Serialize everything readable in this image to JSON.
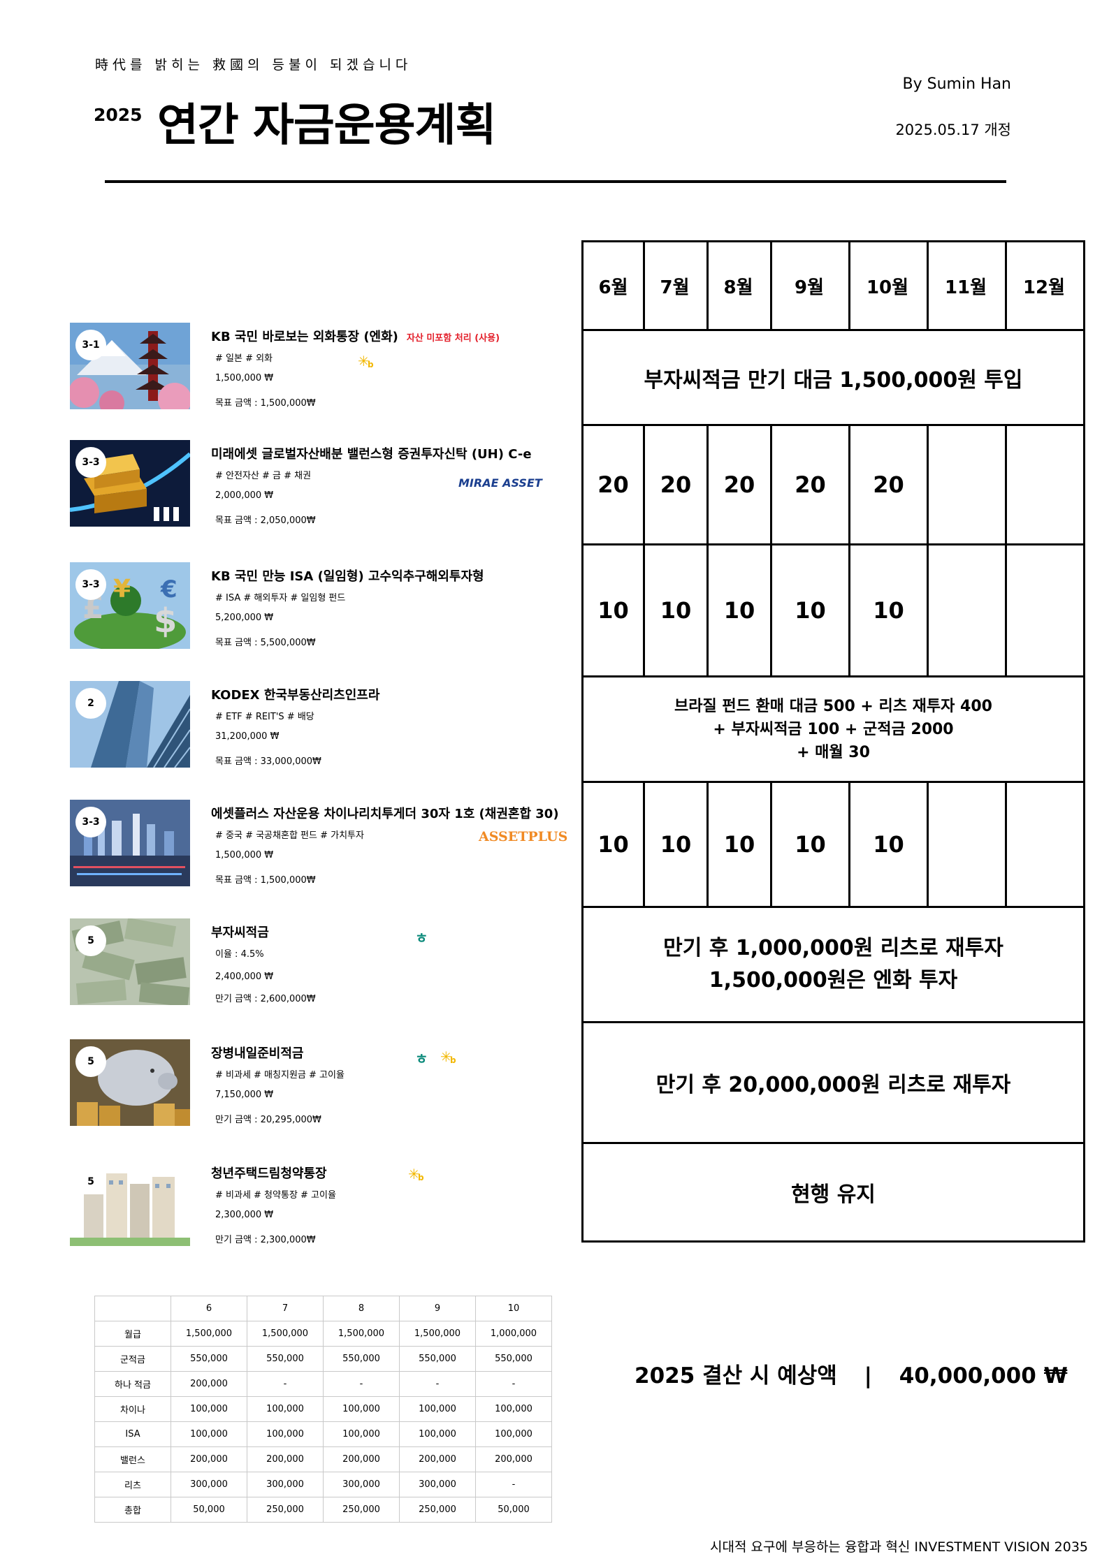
{
  "header": {
    "motto": "時代를 밝히는 救國의 등불이 되겠습니다",
    "year": "2025",
    "title": "연간 자금운용계획",
    "author": "By Sumin Han",
    "revised": "2025.05.17 개정"
  },
  "items": [
    {
      "badge": "3-1",
      "name": "KB 국민 바로보는 외화통장 (엔화)",
      "note": "자산 미포함 처리 (사용)",
      "tags": "# 일본  # 외화",
      "amount": "1,500,000 ₩",
      "target": "목표 금액 : 1,500,000₩",
      "logo_text": "KB",
      "logo_icon": "kb-star-icon",
      "theme": "mount-fuji"
    },
    {
      "badge": "3-3",
      "name": "미래에셋 글로벌자산배분 밸런스형 증권투자신탁 (UH) C-e",
      "note": "",
      "tags": "# 안전자산  # 금  # 채권",
      "amount": "2,000,000 ₩",
      "target": "목표 금액 : 2,050,000₩",
      "logo_text": "MIRAE ASSET",
      "logo_icon": "mirae-asset-logo",
      "theme": "gold-bars"
    },
    {
      "badge": "3-3",
      "name": "KB 국민 만능 ISA (일임형) 고수익추구해외투자형",
      "note": "",
      "tags": "# ISA  # 해외투자  # 일임형 펀드",
      "amount": "5,200,000 ₩",
      "target": "목표 금액 : 5,500,000₩",
      "logo_text": "",
      "logo_icon": "",
      "theme": "currency-globe"
    },
    {
      "badge": "2",
      "name": "KODEX 한국부동산리츠인프라",
      "note": "",
      "tags": "# ETF  # REIT'S  # 배당",
      "amount": "31,200,000 ₩",
      "target": "목표 금액 : 33,000,000₩",
      "logo_text": "",
      "logo_icon": "",
      "theme": "skyscrapers"
    },
    {
      "badge": "3-3",
      "name": "에셋플러스 자산운용 차이나리치투게더 30자 1호 (채권혼합 30)",
      "note": "",
      "tags": "# 중국  # 국공채혼합 펀드  # 가치투자",
      "amount": "1,500,000 ₩",
      "target": "목표 금액 : 1,500,000₩",
      "logo_text": "ASSETPLUS",
      "logo_icon": "assetplus-logo",
      "theme": "city-night"
    },
    {
      "badge": "5",
      "name": "부자씨적금",
      "note": "",
      "tags": "이율 : 4.5%",
      "amount": "2,400,000 ₩",
      "target": "만기 금액 : 2,600,000₩",
      "logo_text": "",
      "logo_icon": "hana-logo-icon",
      "theme": "dollar-bills"
    },
    {
      "badge": "5",
      "name": "장병내일준비적금",
      "note": "",
      "tags": "# 비과세  # 매칭지원금  # 고이율",
      "amount": "7,150,000 ₩",
      "target": "만기 금액 : 20,295,000₩",
      "logo_text": "",
      "logo_icon": "hana-kb-logos",
      "theme": "piggy-bank"
    },
    {
      "badge": "5",
      "name": "청년주택드림청약통장",
      "note": "",
      "tags": "# 비과세  # 청약통장  # 고이율",
      "amount": "2,300,000 ₩",
      "target": "만기 금액 : 2,300,000₩",
      "logo_text": "",
      "logo_icon": "kb-star-icon",
      "theme": "apartments"
    }
  ],
  "grid": {
    "months": [
      "6월",
      "7월",
      "8월",
      "9월",
      "10월",
      "11월",
      "12월"
    ],
    "row1_text": "부자씨적금 만기 대금 1,500,000원 투입",
    "row2_values": [
      "20",
      "20",
      "20",
      "20",
      "20",
      "",
      ""
    ],
    "row3_values": [
      "10",
      "10",
      "10",
      "10",
      "10",
      "",
      ""
    ],
    "row4_lines": [
      "브라질 펀드 환매 대금 500 + 리츠 재투자 400",
      "+ 부자씨적금 100 + 군적금 2000",
      "+ 매월 30"
    ],
    "row5_values": [
      "10",
      "10",
      "10",
      "10",
      "10",
      "",
      ""
    ],
    "row6_lines": [
      "만기 후 1,000,000원 리츠로 재투자",
      "1,500,000원은 엔화 투자"
    ],
    "row7_text": "만기 후 20,000,000원 리츠로 재투자",
    "row8_text": "현행 유지"
  },
  "table": {
    "header": [
      "",
      "6",
      "7",
      "8",
      "9",
      "10"
    ],
    "rows": [
      [
        "월급",
        "1,500,000",
        "1,500,000",
        "1,500,000",
        "1,500,000",
        "1,000,000"
      ],
      [
        "군적금",
        "550,000",
        "550,000",
        "550,000",
        "550,000",
        "550,000"
      ],
      [
        "하나 적금",
        "200,000",
        "-",
        "-",
        "-",
        "-"
      ],
      [
        "차이나",
        "100,000",
        "100,000",
        "100,000",
        "100,000",
        "100,000"
      ],
      [
        "ISA",
        "100,000",
        "100,000",
        "100,000",
        "100,000",
        "100,000"
      ],
      [
        "밸런스",
        "200,000",
        "200,000",
        "200,000",
        "200,000",
        "200,000"
      ],
      [
        "리츠",
        "300,000",
        "300,000",
        "300,000",
        "300,000",
        "-"
      ],
      [
        "총합",
        "50,000",
        "250,000",
        "250,000",
        "250,000",
        "50,000"
      ]
    ]
  },
  "settlement": {
    "label": "2025 결산 시 예상액",
    "separator": "|",
    "amount": "40,000,000 ₩"
  },
  "footer": "시대적 요구에 부응하는 융합과 혁신    INVESTMENT VISION 2035",
  "colors": {
    "note_red": "#e3202b",
    "mirae_blue": "#1b3f8f",
    "mirae_orange": "#f39a1e",
    "assetplus_orange": "#f08a24",
    "hana_teal": "#0a8a7a",
    "kb_yellow": "#f2b700"
  }
}
